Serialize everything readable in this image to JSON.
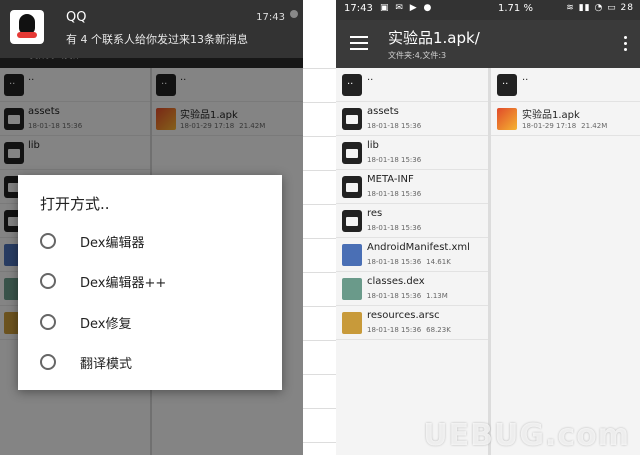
{
  "left": {
    "notification": {
      "app": "QQ",
      "time": "17:43",
      "text": "有 4 个联系人给你发过来13条新消息"
    },
    "subtitle": "文件夹:4,文件:3",
    "pane_a": [
      {
        "name": "..",
        "type": "up"
      },
      {
        "name": "assets",
        "date": "18-01-18 15:36",
        "type": "folder"
      },
      {
        "name": "lib",
        "type": "folder"
      }
    ],
    "pane_b": [
      {
        "name": "..",
        "type": "up"
      },
      {
        "name": "实验品1.apk",
        "date": "18-01-29 17:18",
        "size": "21.42M",
        "type": "apk"
      }
    ],
    "dialog": {
      "title": "打开方式..",
      "options": [
        "Dex编辑器",
        "Dex编辑器++",
        "Dex修复",
        "翻译模式"
      ]
    }
  },
  "right": {
    "status": {
      "time": "17:43",
      "battery_pct": "1.71 %",
      "clock_right": "28"
    },
    "appbar": {
      "title": "实验品1.apk/",
      "subtitle": "文件夹:4,文件:3"
    },
    "pane_a": [
      {
        "name": "..",
        "type": "up"
      },
      {
        "name": "assets",
        "date": "18-01-18 15:36",
        "size": "",
        "type": "folder"
      },
      {
        "name": "lib",
        "date": "18-01-18 15:36",
        "size": "",
        "type": "folder"
      },
      {
        "name": "META-INF",
        "date": "18-01-18 15:36",
        "size": "",
        "type": "folder"
      },
      {
        "name": "res",
        "date": "18-01-18 15:36",
        "size": "",
        "type": "folder"
      },
      {
        "name": "AndroidManifest.xml",
        "date": "18-01-18 15:36",
        "size": "14.61K",
        "type": "xml"
      },
      {
        "name": "classes.dex",
        "date": "18-01-18 15:36",
        "size": "1.13M",
        "type": "dex"
      },
      {
        "name": "resources.arsc",
        "date": "18-01-18 15:36",
        "size": "68.23K",
        "type": "arsc"
      }
    ],
    "pane_b": [
      {
        "name": "..",
        "type": "up"
      },
      {
        "name": "实验品1.apk",
        "date": "18-01-29 17:18",
        "size": "21.42M",
        "type": "apk"
      }
    ]
  },
  "watermark": "UEBUG.com",
  "colors": {
    "appbar": "#3a3a3a",
    "statusbar": "#333333",
    "xml_icon": "#4a6fb5",
    "dex_icon": "#6a9a8a",
    "arsc_icon": "#c89a3a"
  }
}
